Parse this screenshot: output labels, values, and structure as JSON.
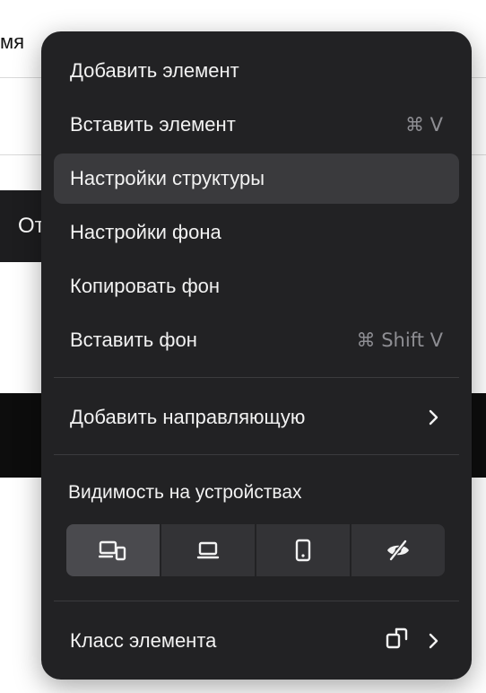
{
  "background": {
    "field_label_fragment": "мя",
    "dark_button_fragment": "От"
  },
  "menu": {
    "items": [
      {
        "label": "Добавить элемент",
        "shortcut": ""
      },
      {
        "label": "Вставить элемент",
        "shortcut": "⌘ V"
      },
      {
        "label": "Настройки структуры",
        "shortcut": "",
        "active": true
      },
      {
        "label": "Настройки фона",
        "shortcut": ""
      },
      {
        "label": "Копировать фон",
        "shortcut": ""
      },
      {
        "label": "Вставить фон",
        "shortcut": "⌘ Shift V"
      }
    ],
    "guide_item": {
      "label": "Добавить направляющую",
      "icon": "chevron-right-icon"
    },
    "visibility": {
      "title": "Видимость на устройствах",
      "options": [
        {
          "icon": "all-devices-icon",
          "selected": true
        },
        {
          "icon": "laptop-icon",
          "selected": false
        },
        {
          "icon": "phone-icon",
          "selected": false
        },
        {
          "icon": "eye-slash-icon",
          "selected": false
        }
      ]
    },
    "class_item": {
      "label": "Класс элемента",
      "icons": [
        "copy-shapes-icon",
        "chevron-right-icon"
      ]
    }
  },
  "colors": {
    "menu_background": "#222224",
    "active_item": "#3a3a3d",
    "shortcut_text": "#8e8e93",
    "selected_device": "#4a4a4e"
  }
}
